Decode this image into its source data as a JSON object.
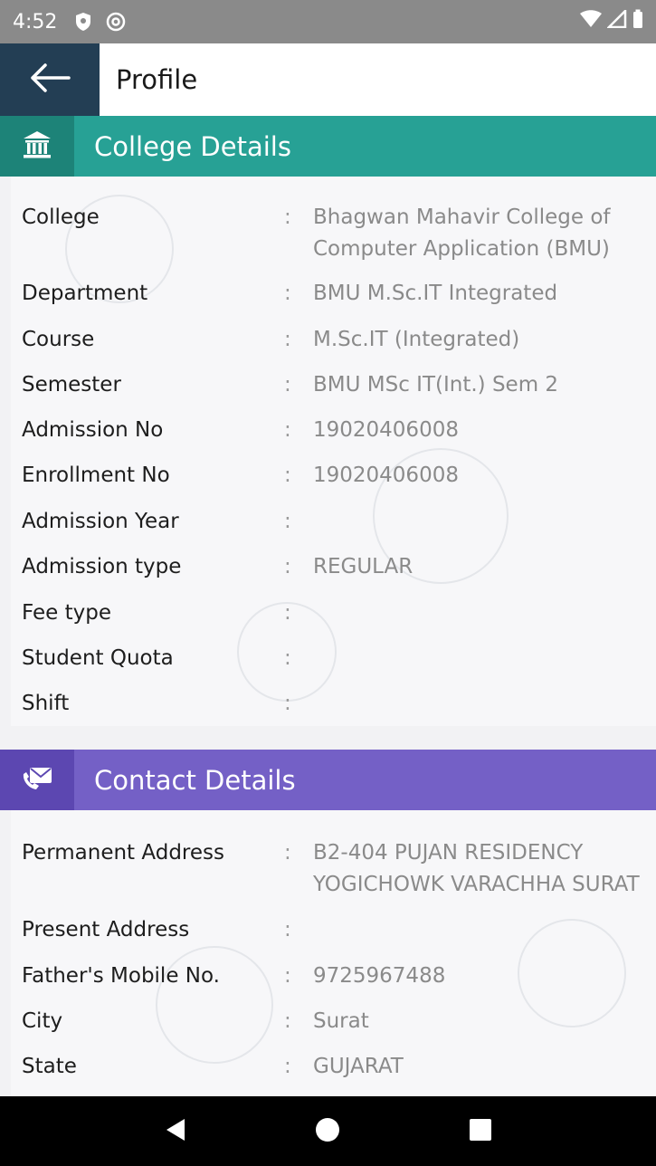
{
  "status_bar": {
    "time": "4:52"
  },
  "app_bar": {
    "title": "Profile"
  },
  "college_section": {
    "title": "College Details",
    "rows": [
      {
        "label": "College",
        "value": "Bhagwan Mahavir College of Computer Application (BMU)"
      },
      {
        "label": "Department",
        "value": "BMU M.Sc.IT Integrated"
      },
      {
        "label": "Course",
        "value": "M.Sc.IT (Integrated)"
      },
      {
        "label": "Semester",
        "value": "BMU MSc IT(Int.) Sem 2"
      },
      {
        "label": "Admission No",
        "value": "19020406008"
      },
      {
        "label": "Enrollment No",
        "value": "19020406008"
      },
      {
        "label": "Admission Year",
        "value": ""
      },
      {
        "label": "Admission type",
        "value": "REGULAR"
      },
      {
        "label": "Fee type",
        "value": ""
      },
      {
        "label": "Student Quota",
        "value": ""
      },
      {
        "label": "Shift",
        "value": ""
      }
    ]
  },
  "contact_section": {
    "title": "Contact Details",
    "rows": [
      {
        "label": "Permanent Address",
        "value": "B2-404 PUJAN RESIDENCY YOGICHOWK VARACHHA SURAT"
      },
      {
        "label": "Present Address",
        "value": ""
      },
      {
        "label": "Father's Mobile No.",
        "value": "9725967488"
      },
      {
        "label": "City",
        "value": "Surat"
      },
      {
        "label": "State",
        "value": "GUJARAT"
      }
    ]
  },
  "colon": ":",
  "icons": {
    "back": "arrow-left-icon",
    "college": "bank-building-icon",
    "contact": "phone-mail-icon",
    "nav_back": "triangle-back-icon",
    "nav_home": "circle-home-icon",
    "nav_recents": "square-recents-icon"
  },
  "colors": {
    "college_header": "#27a195",
    "contact_header": "#7460c6",
    "app_bar_back": "#233e54"
  }
}
